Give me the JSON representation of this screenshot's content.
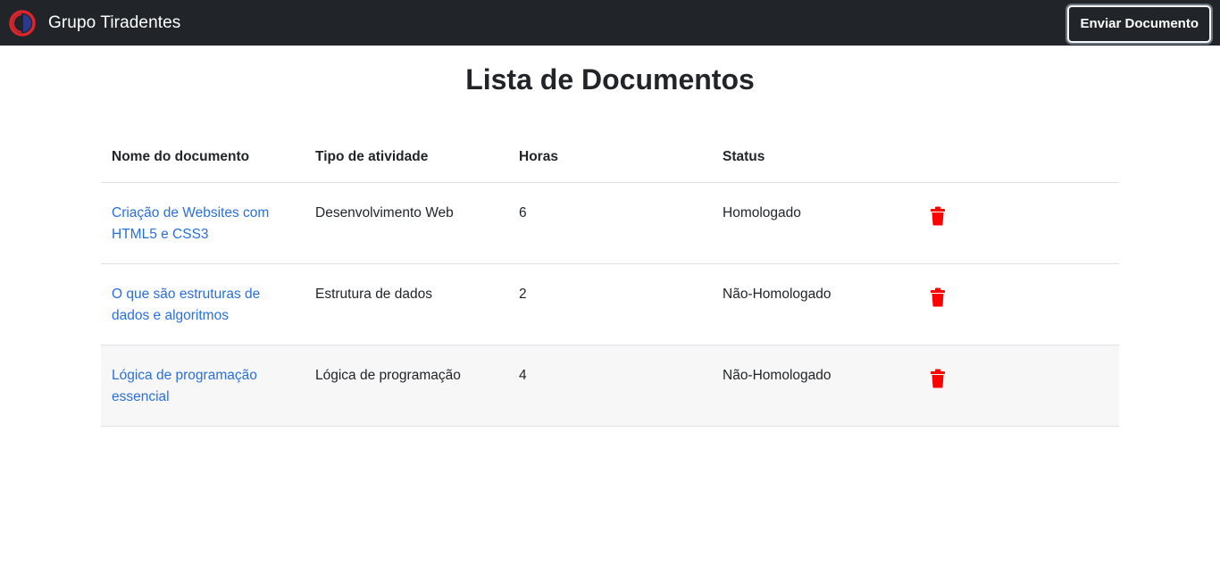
{
  "navbar": {
    "brand_name": "Grupo Tiradentes",
    "send_button_label": "Enviar Documento",
    "logo_icon": "grupo-tiradentes-logo"
  },
  "page": {
    "title": "Lista de Documentos"
  },
  "table": {
    "headers": {
      "name": "Nome do documento",
      "type": "Tipo de atividade",
      "hours": "Horas",
      "status": "Status"
    },
    "rows": [
      {
        "name": "Criação de Websites com HTML5 e CSS3",
        "type": "Desenvolvimento Web",
        "hours": "6",
        "status": "Homologado",
        "action_icon": "trash-icon"
      },
      {
        "name": "O que são estruturas de dados e algoritmos",
        "type": "Estrutura de dados",
        "hours": "2",
        "status": "Não-Homologado",
        "action_icon": "trash-icon"
      },
      {
        "name": "Lógica de programação essencial",
        "type": "Lógica de programação",
        "hours": "4",
        "status": "Não-Homologado",
        "action_icon": "trash-icon"
      }
    ]
  },
  "colors": {
    "navbar_bg": "#212529",
    "link": "#2a6fdb",
    "delete": "#ff0000",
    "striped_row": "#f7f7f7"
  }
}
